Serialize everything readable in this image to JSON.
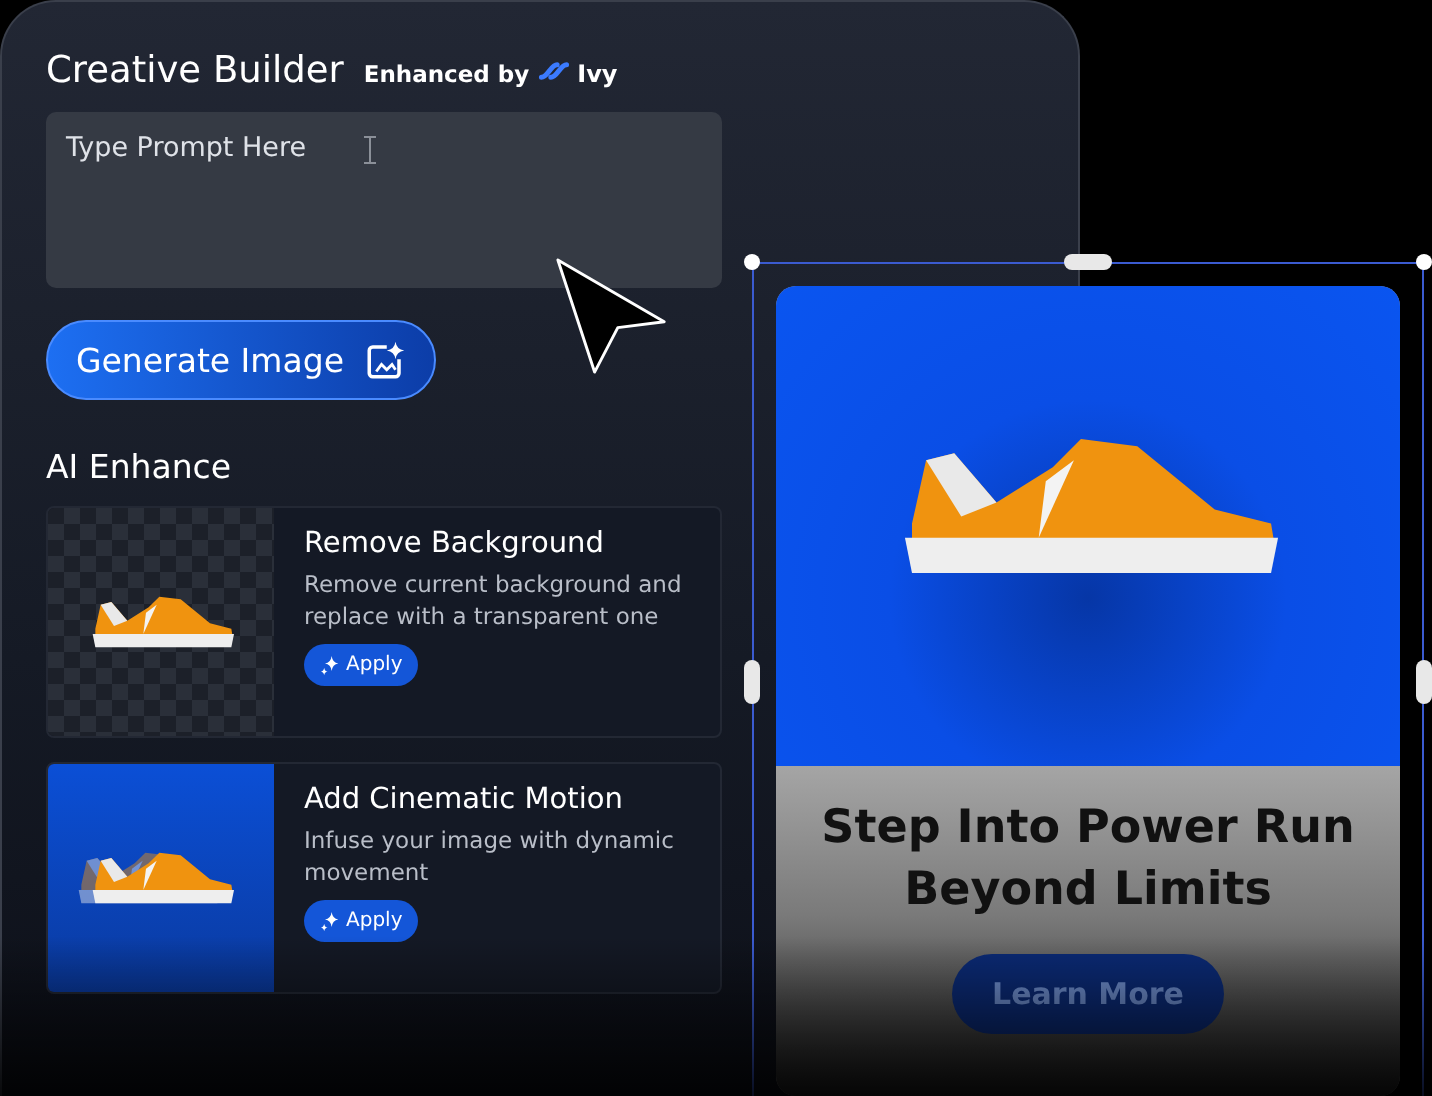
{
  "panel": {
    "title": "Creative Builder",
    "enhanced_by": "Enhanced by",
    "brand": "Ivy",
    "prompt": {
      "placeholder": "Type Prompt Here"
    },
    "generate_button": "Generate Image",
    "section_title": "AI Enhance",
    "enhancements": [
      {
        "kind": "transparent",
        "title": "Remove Background",
        "description": "Remove current background and replace with a transparent one",
        "button": "Apply"
      },
      {
        "kind": "motion",
        "title": "Add Cinematic Motion",
        "description": "Infuse your image with dynamic movement",
        "button": "Apply"
      }
    ]
  },
  "ad": {
    "headline": "Step Into Power Run Beyond Limits",
    "cta": "Learn More"
  }
}
